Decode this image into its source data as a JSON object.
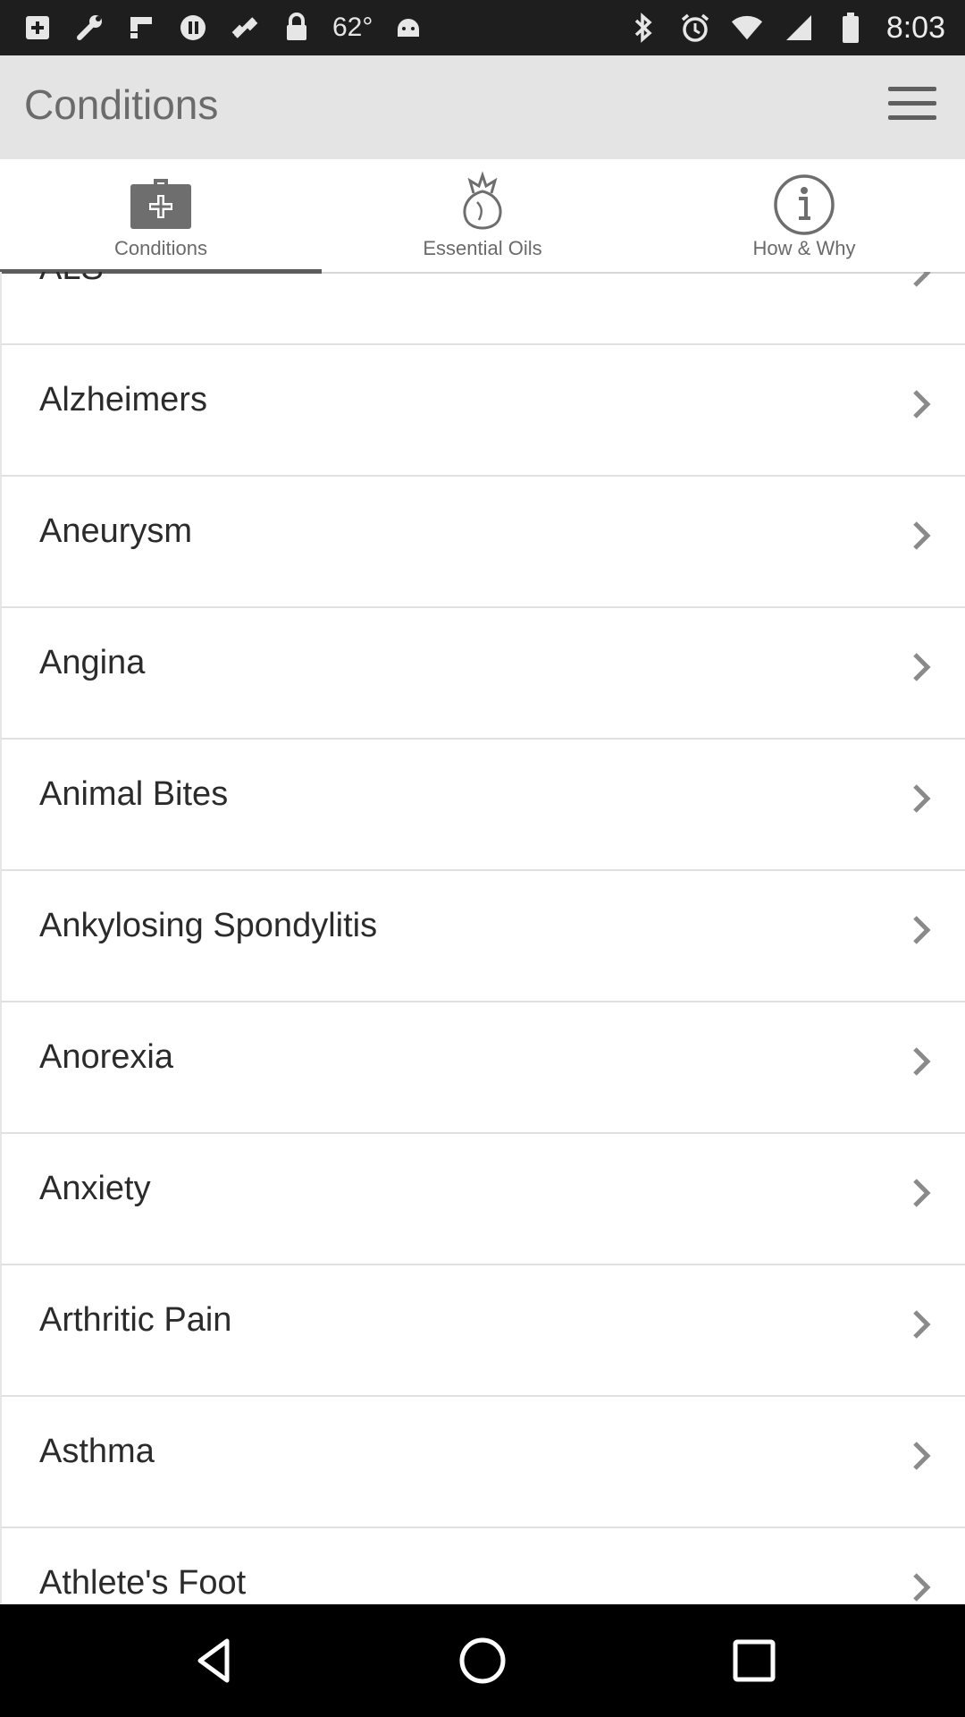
{
  "status_bar": {
    "temperature": "62°",
    "time": "8:03",
    "left_icons": [
      "add-box-icon",
      "wrench-icon",
      "flipboard-icon",
      "circle-pause-icon",
      "fake-gps-icon",
      "lock-icon",
      "android-icon"
    ],
    "right_icons": [
      "bluetooth-icon",
      "alarm-icon",
      "wifi-icon",
      "signal-icon",
      "battery-icon"
    ]
  },
  "toolbar": {
    "title": "Conditions",
    "menu_icon": "hamburger-menu-icon"
  },
  "tabs": [
    {
      "label": "Conditions",
      "icon": "medical-kit-icon",
      "selected": true
    },
    {
      "label": "Essential Oils",
      "icon": "flower-bottle-icon",
      "selected": false
    },
    {
      "label": "How & Why",
      "icon": "info-icon",
      "selected": false
    }
  ],
  "list": {
    "items": [
      {
        "label": "ALS"
      },
      {
        "label": "Alzheimers"
      },
      {
        "label": "Aneurysm"
      },
      {
        "label": "Angina"
      },
      {
        "label": "Animal Bites"
      },
      {
        "label": "Ankylosing Spondylitis"
      },
      {
        "label": "Anorexia"
      },
      {
        "label": "Anxiety"
      },
      {
        "label": "Arthritic Pain"
      },
      {
        "label": "Asthma"
      },
      {
        "label": "Athlete's Foot"
      }
    ]
  },
  "nav_bar": {
    "icons": [
      "back-icon",
      "home-icon",
      "recents-icon"
    ]
  },
  "colors": {
    "toolbar_bg": "#e4e4e4",
    "status_bar_bg": "#1e1e1e",
    "tab_indicator": "#5d5d5d",
    "text_primary": "#2b2b2b"
  }
}
